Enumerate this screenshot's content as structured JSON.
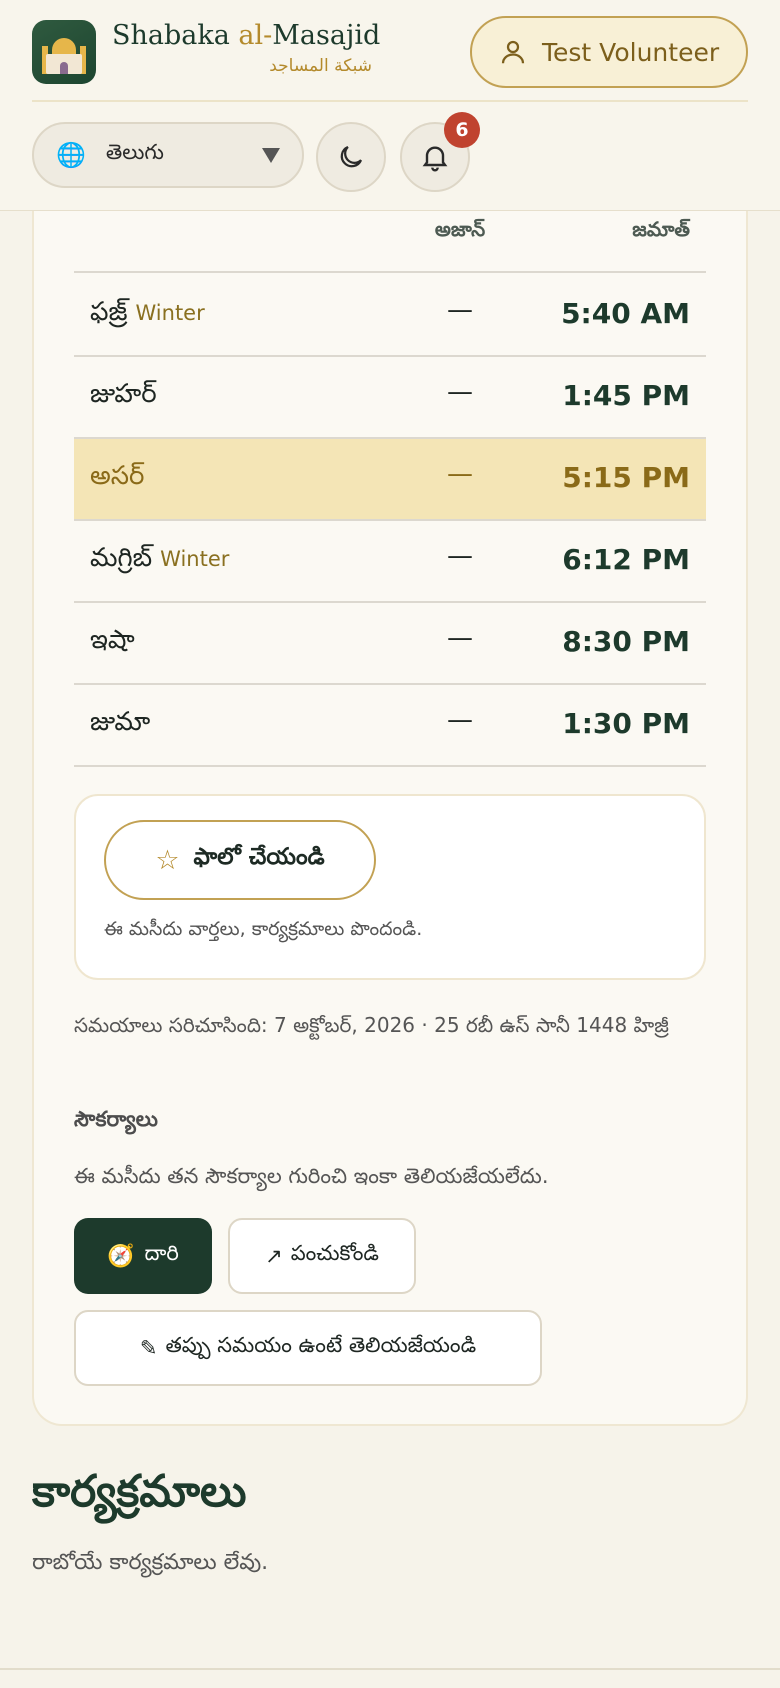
{
  "brand": {
    "title_part1": "Shabaka ",
    "title_accent": "al-",
    "title_part2": "Masajid",
    "arabic": "شبكة المساجد"
  },
  "user": {
    "name": "Test Volunteer"
  },
  "language": {
    "selected": "తెలుగు"
  },
  "notifications": {
    "count": "6"
  },
  "table": {
    "col_adhan": "అజాన్",
    "col_jamat": "జమాత్",
    "rows": [
      {
        "name": "ఫజ్ర్",
        "season": "Winter",
        "adhan": "—",
        "jamat": "5:40 AM",
        "current": false
      },
      {
        "name": "జుహర్",
        "season": "",
        "adhan": "—",
        "jamat": "1:45 PM",
        "current": false
      },
      {
        "name": "అసర్",
        "season": "",
        "adhan": "—",
        "jamat": "5:15 PM",
        "current": true
      },
      {
        "name": "మగ్రిబ్",
        "season": "Winter",
        "adhan": "—",
        "jamat": "6:12 PM",
        "current": false
      },
      {
        "name": "ఇషా",
        "season": "",
        "adhan": "—",
        "jamat": "8:30 PM",
        "current": false
      },
      {
        "name": "జుమా",
        "season": "",
        "adhan": "—",
        "jamat": "1:30 PM",
        "current": false
      }
    ]
  },
  "follow": {
    "label": "ఫాలో చేయండి",
    "description": "ఈ మసీదు వార్తలు, కార్యక్రమాలు పొందండి."
  },
  "checked_line": "సమయాలు సరిచూసింది: 7 అక్టోబర్, 2026 · 25 రబీ ఉస్ సానీ 1448 హిజ్రీ",
  "amenities": {
    "title": "సౌకర్యాలు",
    "text": "ఈ మసీదు తన సౌకర్యాల గురించి ఇంకా తెలియజేయలేదు."
  },
  "actions": {
    "directions": "దారి",
    "share": "పంచుకోండి",
    "report": "తప్పు సమయం ఉంటే తెలియజేయండి"
  },
  "events": {
    "title": "కార్యక్రమాలు",
    "empty": "రాబోయే కార్యక్రమాలు లేవు."
  }
}
